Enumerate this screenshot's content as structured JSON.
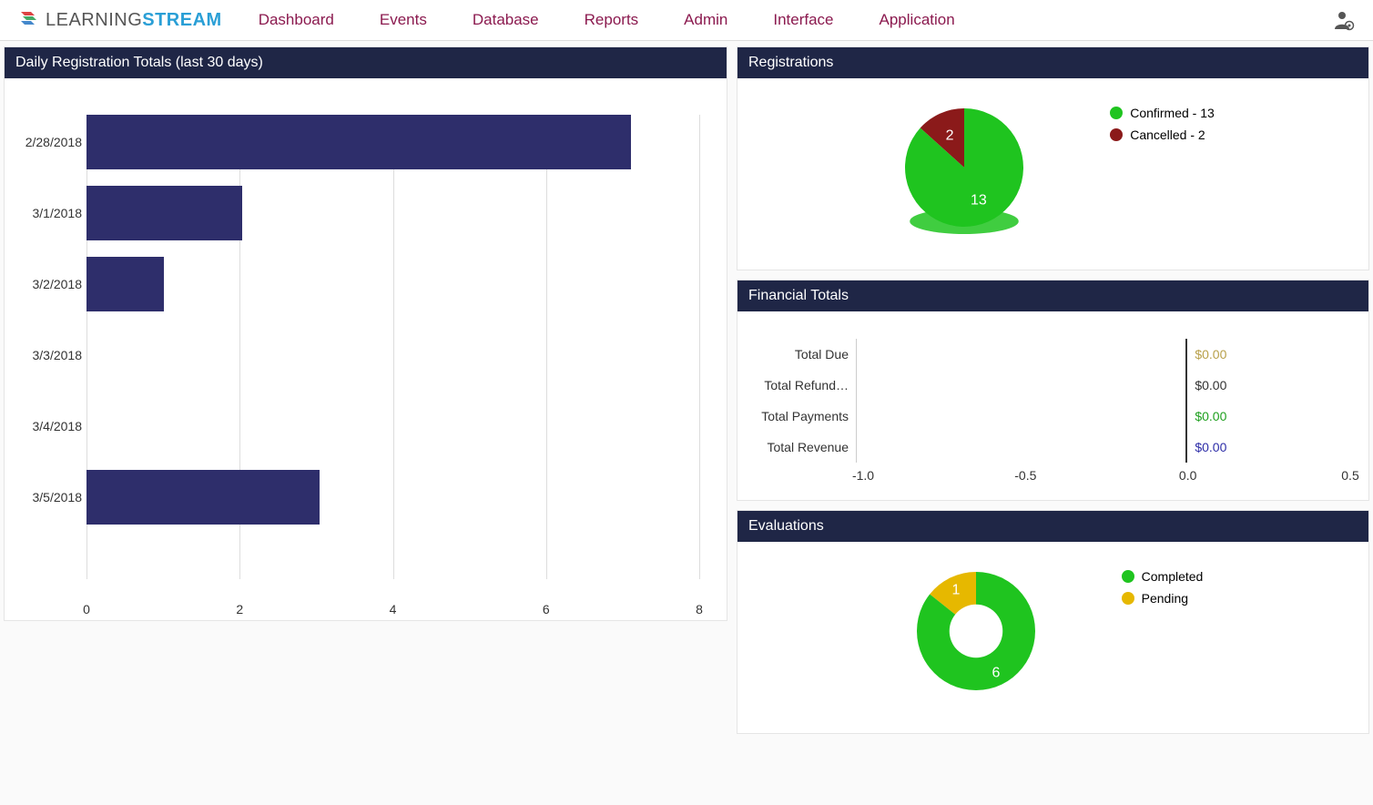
{
  "brand": {
    "part1": "LEARNING",
    "part2": "STREAM"
  },
  "nav": [
    "Dashboard",
    "Events",
    "Database",
    "Reports",
    "Admin",
    "Interface",
    "Application"
  ],
  "panels": {
    "daily": {
      "title": "Daily Registration Totals (last 30 days)"
    },
    "registrations": {
      "title": "Registrations"
    },
    "financial": {
      "title": "Financial Totals"
    },
    "evaluations": {
      "title": "Evaluations"
    }
  },
  "reg_legend": {
    "confirmed": "Confirmed - 13",
    "cancelled": "Cancelled - 2"
  },
  "eval_legend": {
    "completed": "Completed",
    "pending": "Pending"
  },
  "colors": {
    "bar": "#2e2e6b",
    "green": "#1fc41f",
    "darkred": "#8b1a1a",
    "gold": "#e6b800",
    "due": "#b8a04a",
    "refund": "#333333",
    "payments": "#1fa01f",
    "revenue": "#2e2ea8"
  },
  "chart_data": [
    {
      "type": "bar",
      "title": "Daily Registration Totals (last 30 days)",
      "orientation": "horizontal",
      "categories": [
        "2/28/2018",
        "3/1/2018",
        "3/2/2018",
        "3/3/2018",
        "3/4/2018",
        "3/5/2018"
      ],
      "values": [
        7,
        2,
        1,
        0,
        0,
        3
      ],
      "xlim": [
        0,
        8
      ],
      "xticks": [
        0,
        2,
        4,
        6,
        8
      ]
    },
    {
      "type": "pie",
      "title": "Registrations",
      "series": [
        {
          "name": "Confirmed",
          "value": 13,
          "color": "#1fc41f"
        },
        {
          "name": "Cancelled",
          "value": 2,
          "color": "#8b1a1a"
        }
      ]
    },
    {
      "type": "bar",
      "title": "Financial Totals",
      "orientation": "horizontal",
      "categories": [
        "Total Due",
        "Total Refund…",
        "Total Payments",
        "Total Revenue"
      ],
      "values": [
        0.0,
        0.0,
        0.0,
        0.0
      ],
      "value_labels": [
        "$0.00",
        "$0.00",
        "$0.00",
        "$0.00"
      ],
      "value_colors": [
        "#b8a04a",
        "#333333",
        "#1fa01f",
        "#2e2ea8"
      ],
      "xlim": [
        -1.0,
        0.5
      ],
      "xticks": [
        -1.0,
        -0.5,
        0.0,
        0.5
      ]
    },
    {
      "type": "pie",
      "title": "Evaluations",
      "donut": true,
      "series": [
        {
          "name": "Completed",
          "value": 6,
          "color": "#1fc41f"
        },
        {
          "name": "Pending",
          "value": 1,
          "color": "#e6b800"
        }
      ]
    }
  ]
}
